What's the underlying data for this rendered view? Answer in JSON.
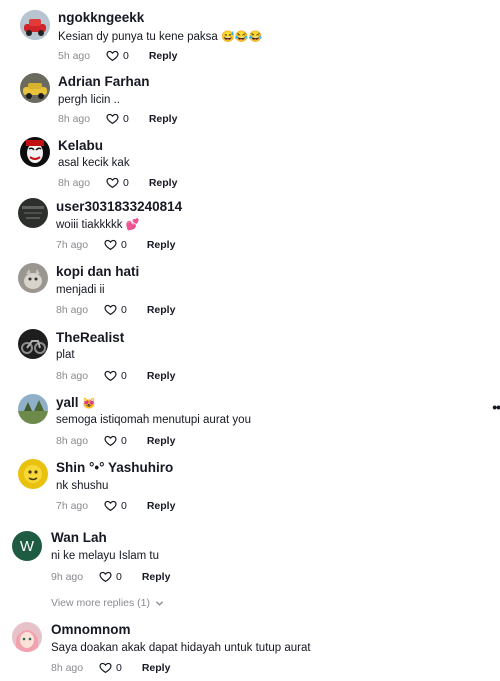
{
  "comments": [
    {
      "username": "ngokkngeekk",
      "text": "Kesian dy punya tu kene paksa",
      "emoji": "😅😂😂",
      "time": "5h ago",
      "likes": "0",
      "reply": "Reply",
      "avatar_icon": "red-car-avatar"
    },
    {
      "username": "Adrian Farhan",
      "text": "pergh licin ..",
      "time": "8h ago",
      "likes": "0",
      "reply": "Reply",
      "avatar_icon": "yellow-car-avatar"
    },
    {
      "username": "Kelabu",
      "text": "asal kecik kak",
      "time": "8h ago",
      "likes": "0",
      "reply": "Reply",
      "avatar_icon": "mask-avatar"
    },
    {
      "username": "user3031833240814",
      "text": "woiii tiakkkkk",
      "emoji": "💕",
      "time": "7h ago",
      "likes": "0",
      "reply": "Reply",
      "avatar_icon": "dark-photo-avatar"
    },
    {
      "username": "kopi dan hati",
      "text": "menjadi ii",
      "time": "8h ago",
      "likes": "0",
      "reply": "Reply",
      "avatar_icon": "cat-avatar"
    },
    {
      "username": "TheRealist",
      "text": "plat",
      "time": "8h ago",
      "likes": "0",
      "reply": "Reply",
      "avatar_icon": "motorcycle-avatar"
    },
    {
      "username": "yall",
      "username_emoji": "😻",
      "text": "semoga istiqomah menutupi aurat you",
      "time": "8h ago",
      "likes": "0",
      "reply": "Reply",
      "avatar_icon": "landscape-avatar"
    },
    {
      "username": "Shin °•° Yashuhiro",
      "text": "nk shushu",
      "time": "7h ago",
      "likes": "0",
      "reply": "Reply",
      "avatar_icon": "yellow-character-avatar"
    },
    {
      "username": "Wan Lah",
      "text": "ni ke melayu Islam tu",
      "time": "9h ago",
      "likes": "0",
      "reply": "Reply",
      "avatar_letter": "W",
      "avatar_color": "#1f5b43"
    },
    {
      "username": "Omnomnom",
      "text": "Saya doakan akak dapat hidayah untuk tutup aurat",
      "time": "8h ago",
      "likes": "0",
      "reply": "Reply",
      "avatar_icon": "anime-girl-avatar"
    }
  ],
  "view_more_replies": "View more replies (1)",
  "colors": {
    "text": "#161823",
    "muted": "#8a8b91",
    "background": "#ffffff"
  }
}
